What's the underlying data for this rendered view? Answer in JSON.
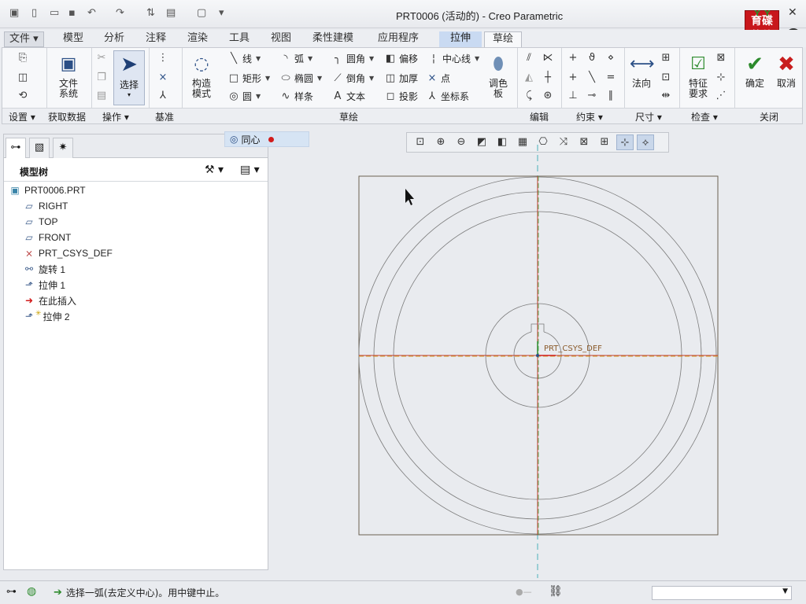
{
  "window": {
    "title": "PRT0006 (活动的) - Creo Parametric",
    "logo_text": "育碟\n软件",
    "help": "?"
  },
  "menubar": {
    "tabs": [
      "文件",
      "模型",
      "分析",
      "注释",
      "渲染",
      "工具",
      "视图",
      "柔性建模",
      "应用程序",
      "拉伸",
      "草绘"
    ]
  },
  "ribbon": {
    "setup": {
      "group": "设置"
    },
    "getdata": {
      "label": "文件\n系统",
      "group": "获取数据"
    },
    "ops": {
      "select_label": "选择",
      "group": "操作"
    },
    "datum": {
      "group": "基准"
    },
    "construct": {
      "label": "构造\n模式"
    },
    "sketch": {
      "group": "草绘",
      "items": [
        "线",
        "弧",
        "圆角",
        "偏移",
        "中心线",
        "矩形",
        "椭圆",
        "倒角",
        "加厚",
        "点",
        "圆",
        "样条",
        "文本",
        "投影",
        "坐标系"
      ],
      "palette_label": "调色\n板"
    },
    "edit": {
      "group": "编辑"
    },
    "constrain": {
      "group": "约束"
    },
    "dimension": {
      "group": "尺寸",
      "normal_label": "法向"
    },
    "inspect": {
      "group": "检查",
      "feature_req_label": "特征\n要求"
    },
    "close": {
      "group": "关闭",
      "ok_label": "确定",
      "cancel_label": "取消"
    }
  },
  "sidebar": {
    "tree_title": "模型树",
    "items": [
      {
        "label": "PRT0006.PRT",
        "icon": "part-icon"
      },
      {
        "label": "RIGHT",
        "icon": "datum-plane-icon"
      },
      {
        "label": "TOP",
        "icon": "datum-plane-icon"
      },
      {
        "label": "FRONT",
        "icon": "datum-plane-icon"
      },
      {
        "label": "PRT_CSYS_DEF",
        "icon": "csys-icon"
      },
      {
        "label": "旋转 1",
        "icon": "revolve-icon"
      },
      {
        "label": "拉伸 1",
        "icon": "extrude-icon"
      },
      {
        "label": "在此插入",
        "icon": "insert-arrow-icon"
      },
      {
        "label": "拉伸 2",
        "icon": "extrude-icon"
      }
    ]
  },
  "hint_tag": {
    "label": "同心"
  },
  "canvas": {
    "csys_label": "PRT_CSYS_DEF"
  },
  "status": {
    "message": "选择一弧(去定义中心)。用中键中止。"
  },
  "colors": {
    "accent": "#2b4f86",
    "context_tab": "#c9daf2",
    "logo": "#c8171c",
    "ok": "#2c8a2c",
    "cancel": "#c81e1e"
  }
}
